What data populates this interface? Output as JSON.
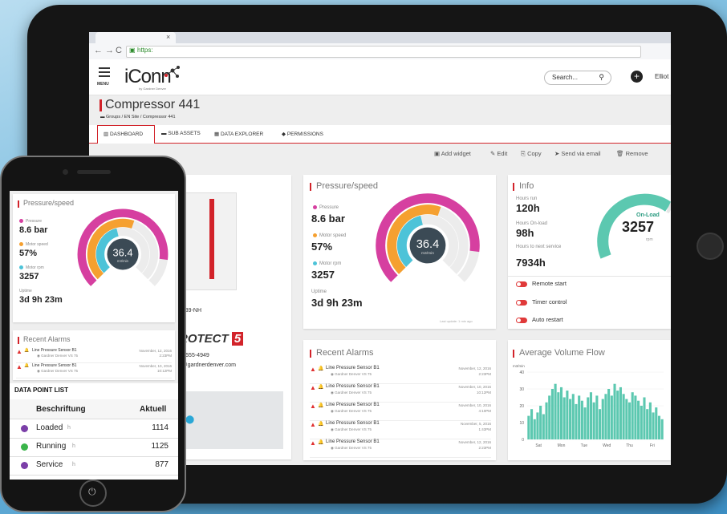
{
  "browser": {
    "url": "https:"
  },
  "app": {
    "menu_label": "MENU",
    "logo_main": "iConn",
    "logo_sub": "by Gardner Denver",
    "search_placeholder": "Search...",
    "user_name": "Elliot"
  },
  "page": {
    "title": "Compressor 441",
    "breadcrumb": "Groups / EN Site / Compressor 441",
    "tabs": [
      "DASHBOARD",
      "SUB ASSETS",
      "DATA EXPLORER",
      "PERMISSIONS"
    ]
  },
  "toolbar": {
    "add_widget": "Add widget",
    "edit": "Edit",
    "copy": "Copy",
    "send": "Send via email",
    "remove": "Remove"
  },
  "asset_card": {
    "serial": "9439-NH",
    "brand": "ROTECT",
    "brand_num": "5",
    "phone": "2) 555-4949",
    "email": "k@gardnerdenver.com"
  },
  "pressure_speed": {
    "title": "Pressure/speed",
    "pressure_label": "Pressure",
    "pressure_value": "8.6 bar",
    "motor_speed_label": "Motor speed",
    "motor_speed_value": "57%",
    "motor_rpm_label": "Motor rpm",
    "motor_rpm_value": "3257",
    "uptime_label": "Uptime",
    "uptime_value": "3d 9h 23m",
    "center_value": "36.4",
    "center_unit": "m3/min",
    "updated": "Last update: 1 min ago",
    "pressure_fraction": 0.86,
    "speed_fraction": 0.57,
    "rpm_fraction": 0.45
  },
  "info": {
    "title": "Info",
    "hours_run_label": "Hours run",
    "hours_run_value": "120h",
    "hours_onload_label": "Hours On-load",
    "hours_onload_value": "98h",
    "hours_service_label": "Hours to next service",
    "hours_service_value": "7934h",
    "gauge_label": "On-Load",
    "gauge_value": "3257",
    "gauge_unit": "rpm",
    "toggles": [
      "Remote start",
      "Timer control",
      "Auto restart"
    ]
  },
  "alarms": {
    "title": "Recent Alarms",
    "rows": [
      {
        "name": "Line Pressure Sensor B1",
        "sub": "Gardner Denver VS 75",
        "date": "November, 12, 2016",
        "time": "2:23PM"
      },
      {
        "name": "Line Pressure Sensor B1",
        "sub": "Gardner Denver VS 75",
        "date": "November, 10, 2016",
        "time": "10:12PM"
      },
      {
        "name": "Line Pressure Sensor B1",
        "sub": "Gardner Denver VS 75",
        "date": "November, 10, 2016",
        "time": "4:10PM"
      },
      {
        "name": "Line Pressure Sensor B1",
        "sub": "Gardner Denver VS 75",
        "date": "November, 5, 2016",
        "time": "1:43PM"
      },
      {
        "name": "Line Pressure Sensor B1",
        "sub": "Gardner Denver VS 75",
        "date": "November, 12, 2016",
        "time": "2:23PM"
      }
    ]
  },
  "volume_flow": {
    "title": "Average Volume Flow",
    "unit": "m3/min",
    "yticks": [
      "40",
      "30",
      "20",
      "10",
      "0"
    ],
    "xticks": [
      "Sat",
      "Mon",
      "Tue",
      "Wed",
      "Thu",
      "Fri"
    ],
    "color": "#5cc8b0"
  },
  "chart_data": {
    "type": "bar",
    "title": "Average Volume Flow",
    "ylabel": "m3/min",
    "ylim": [
      0,
      40
    ],
    "categories": [
      "Sat",
      "Mon",
      "Tue",
      "Wed",
      "Thu",
      "Fri"
    ],
    "values": [
      14,
      18,
      12,
      16,
      20,
      15,
      22,
      26,
      30,
      33,
      28,
      31,
      25,
      29,
      24,
      27,
      21,
      26,
      23,
      19,
      25,
      28,
      22,
      26,
      18,
      24,
      27,
      30,
      26,
      33,
      29,
      31,
      27,
      24,
      22,
      28,
      26,
      23,
      20,
      25,
      18,
      22,
      16,
      19,
      14,
      12
    ]
  },
  "phone": {
    "pressure_title": "Pressure/speed",
    "pressure_label": "Pressure",
    "pressure_value": "8.6 bar",
    "motor_speed_label": "Motor speed",
    "motor_speed_value": "57%",
    "motor_rpm_label": "Motor rpm",
    "motor_rpm_value": "3257",
    "uptime_label": "Uptime",
    "uptime_value": "3d 9h 23m",
    "center_value": "36.4",
    "center_unit": "m3/min",
    "alarms_title": "Recent Alarms",
    "alarm_rows": [
      {
        "name": "Line Pressure Sensor B1",
        "sub": "Gardner Denver VS 75",
        "date": "November, 12, 2016",
        "time": "2:23PM"
      },
      {
        "name": "Line Pressure Sensor B1",
        "sub": "Gardner Denver VS 75",
        "date": "November, 10, 2016",
        "time": "10:12PM"
      }
    ],
    "dpl_title": "DATA POINT LIST",
    "dpl_col1": "Beschriftung",
    "dpl_col2": "Aktuell",
    "dpl_rows": [
      {
        "label": "Loaded",
        "unit": "h",
        "value": "1114",
        "color": "#7b3fa8"
      },
      {
        "label": "Running",
        "unit": "h",
        "value": "1125",
        "color": "#3ab54a"
      },
      {
        "label": "Service",
        "unit": "h",
        "value": "877",
        "color": "#7b3fa8"
      }
    ]
  },
  "colors": {
    "pressure": "#d63fa0",
    "speed": "#f5a030",
    "rpm": "#4dc3d8",
    "accent": "#d2232a",
    "center": "#3b4a55"
  }
}
